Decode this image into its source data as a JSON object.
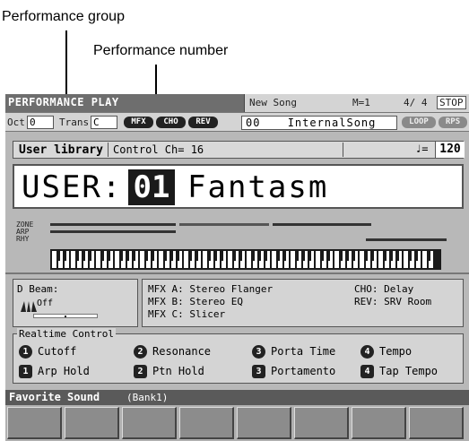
{
  "callouts": {
    "group_label": "Performance group",
    "number_label": "Performance number"
  },
  "header": {
    "mode": "PERFORMANCE PLAY",
    "song_title": "New Song",
    "measure": "M=1",
    "beat": "4/ 4",
    "status": "STOP"
  },
  "controls_row": {
    "oct_label": "Oct",
    "oct_value": "0",
    "trans_label": "Trans",
    "trans_value": "C",
    "fx_buttons": [
      "MFX",
      "CHO",
      "REV"
    ],
    "song_number": "00",
    "song_name": "InternalSong",
    "right_buttons": [
      "LOOP",
      "RPS"
    ]
  },
  "library_bar": {
    "library": "User library",
    "control_channel": "Control Ch= 16",
    "tempo_symbol": "♩=",
    "tempo": "120"
  },
  "performance": {
    "group": "USER:",
    "number": "01",
    "name": "Fantasm"
  },
  "lanes": {
    "labels": [
      "ZONE",
      "ARP",
      "RHY"
    ]
  },
  "dbeam": {
    "title": "D Beam:",
    "value": "Off"
  },
  "effects": {
    "mfx_a": "MFX A: Stereo Flanger",
    "mfx_b": "MFX B: Stereo EQ",
    "mfx_c": "MFX C: Slicer",
    "cho": "CHO: Delay",
    "rev": "REV: SRV Room"
  },
  "realtime": {
    "legend": "Realtime Control",
    "items": [
      {
        "badge": "1",
        "label": "Cutoff"
      },
      {
        "badge": "2",
        "label": "Resonance"
      },
      {
        "badge": "3",
        "label": "Porta Time"
      },
      {
        "badge": "4",
        "label": "Tempo"
      },
      {
        "badge": "1",
        "label": "Arp Hold"
      },
      {
        "badge": "2",
        "label": "Ptn Hold"
      },
      {
        "badge": "3",
        "label": "Portamento"
      },
      {
        "badge": "4",
        "label": "Tap Tempo"
      }
    ]
  },
  "favorite": {
    "title": "Favorite Sound",
    "bank": "(Bank1)"
  },
  "colors": {
    "screen_bg": "#b8b8b8",
    "title_bar": "#6e6e6e",
    "panel_bg": "#d4d4d4",
    "highlight": "#1a1a1a"
  }
}
